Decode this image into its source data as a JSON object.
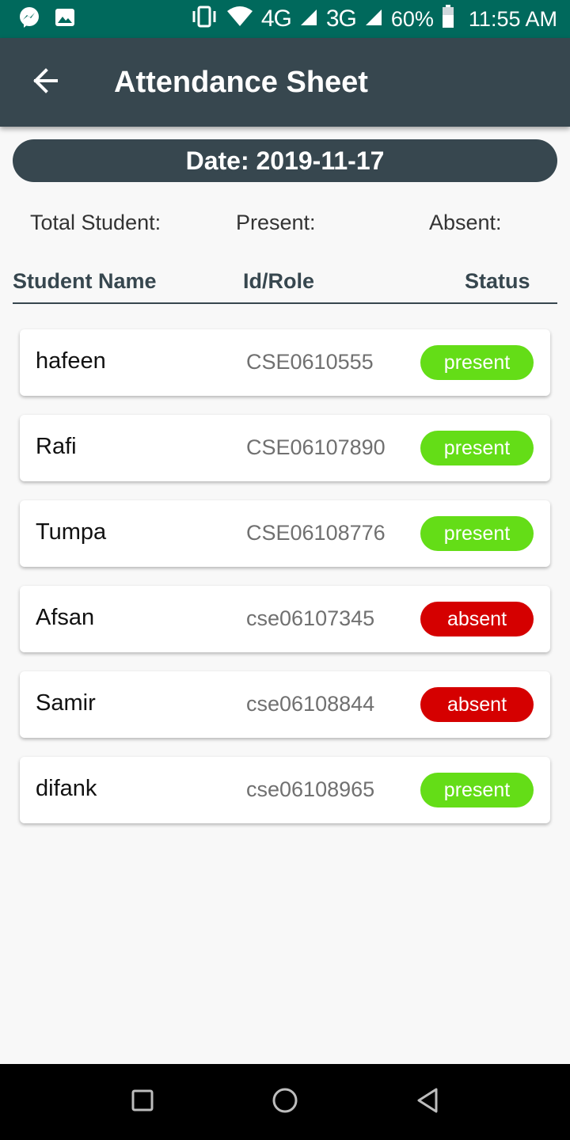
{
  "status_bar": {
    "net1": "4G",
    "net2": "3G",
    "battery": "60%",
    "time": "11:55 AM"
  },
  "app_bar": {
    "title": "Attendance Sheet"
  },
  "date_label": "Date: 2019-11-17",
  "summary": {
    "total_label": "Total Student:",
    "present_label": "Present:",
    "absent_label": "Absent:"
  },
  "table": {
    "headers": [
      "Student Name",
      "Id/Role",
      "Status"
    ],
    "rows": [
      {
        "name": "hafeen",
        "id": "CSE0610555",
        "status": "present"
      },
      {
        "name": "Rafi",
        "id": "CSE06107890",
        "status": "present"
      },
      {
        "name": "Tumpa",
        "id": "CSE06108776",
        "status": "present"
      },
      {
        "name": "Afsan",
        "id": "cse06107345",
        "status": "absent"
      },
      {
        "name": "Samir",
        "id": "cse06108844",
        "status": "absent"
      },
      {
        "name": "difank",
        "id": "cse06108965",
        "status": "present"
      }
    ]
  },
  "colors": {
    "status_bar": "#00695c",
    "app_bar": "#37474f",
    "present": "#64dd17",
    "absent": "#d50000"
  },
  "icons": {
    "status_left": [
      "messenger-icon",
      "image-icon"
    ],
    "status_right": [
      "vibrate-icon",
      "wifi-icon",
      "signal-icon",
      "signal-icon",
      "battery-icon"
    ],
    "app_bar": "back-arrow-icon",
    "nav": [
      "recent-apps-icon",
      "home-icon",
      "back-icon"
    ]
  }
}
